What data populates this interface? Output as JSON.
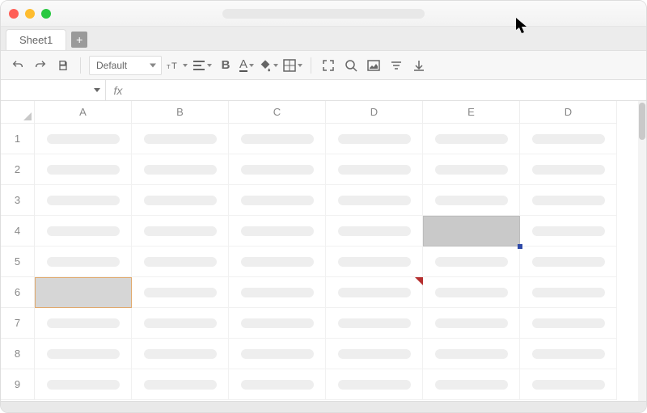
{
  "window": {
    "title_placeholder": ""
  },
  "tabs": {
    "items": [
      {
        "label": "Sheet1"
      }
    ],
    "add_label": "+"
  },
  "toolbar": {
    "undo": "undo",
    "redo": "redo",
    "save": "save",
    "font_select": "Default",
    "bold_label": "B",
    "font_color_label": "A"
  },
  "formula_bar": {
    "namebox_value": "",
    "fx_label": "fx",
    "formula_value": ""
  },
  "grid": {
    "columns": [
      "A",
      "B",
      "C",
      "D",
      "E",
      "D"
    ],
    "rows": [
      "1",
      "2",
      "3",
      "4",
      "5",
      "6",
      "7",
      "8",
      "9"
    ]
  },
  "selection": {
    "primary_cell": "E4",
    "secondary_outlined_cell": "A6",
    "comment_marker_cell": "D6"
  }
}
